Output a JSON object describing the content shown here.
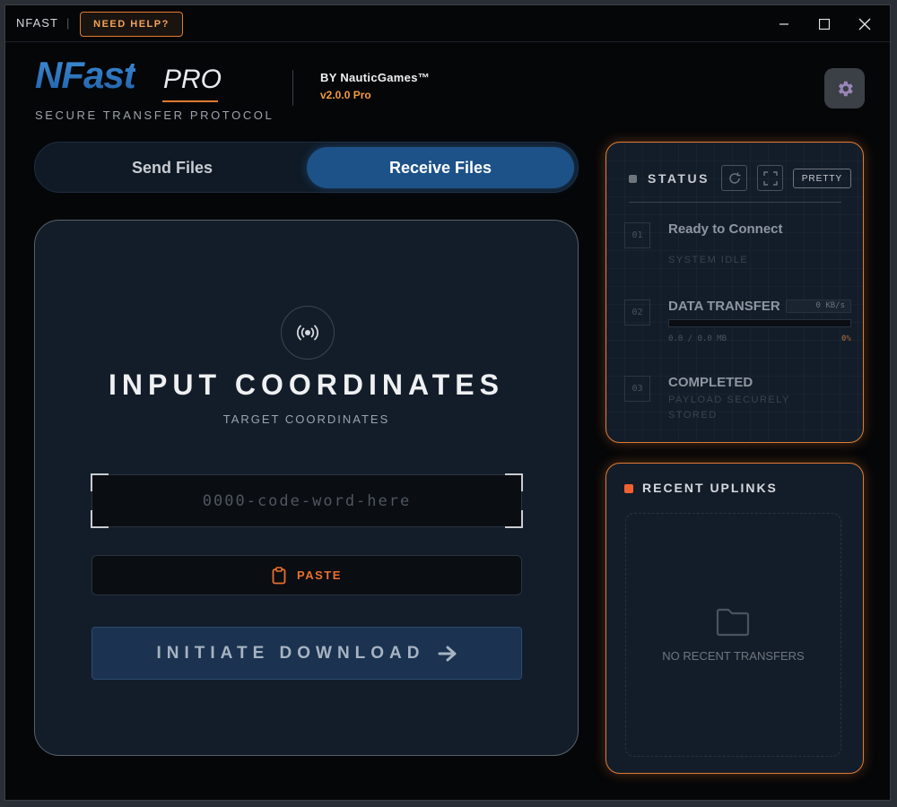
{
  "titlebar": {
    "app_name": "NFAST",
    "separator": "|",
    "help_label": "NEED HELP?"
  },
  "header": {
    "logo_main": "NFast",
    "logo_pro": "PRO",
    "tagline": "SECURE TRANSFER PROTOCOL",
    "by_line": "BY NauticGames™",
    "version": "v2.0.0 Pro"
  },
  "tabs": [
    {
      "label": "Send Files",
      "active": false
    },
    {
      "label": "Receive Files",
      "active": true
    }
  ],
  "receive": {
    "title": "INPUT COORDINATES",
    "subtitle": "TARGET COORDINATES",
    "code_placeholder": "0000-code-word-here",
    "code_value": "",
    "paste_label": "PASTE",
    "download_label": "INITIATE DOWNLOAD"
  },
  "status": {
    "title": "STATUS",
    "pretty_label": "PRETTY",
    "steps": [
      {
        "num": "01",
        "title": "Ready to Connect",
        "sub": "SYSTEM IDLE"
      },
      {
        "num": "02",
        "title": "DATA TRANSFER",
        "speed": "0 KB/s",
        "size": "0.0 / 0.0 MB",
        "percent": "0%",
        "progress": 0
      },
      {
        "num": "03",
        "title": "COMPLETED",
        "sub_line1": "PAYLOAD SECURELY",
        "sub_line2": "STORED"
      }
    ]
  },
  "recent": {
    "title": "RECENT UPLINKS",
    "empty_text": "NO RECENT TRANSFERS"
  },
  "colors": {
    "accent_orange": "#e07a30",
    "accent_blue": "#1c5288",
    "panel_bg": "#131d2a"
  },
  "icons": [
    "minimize-icon",
    "maximize-icon",
    "close-icon",
    "gear-icon",
    "broadcast-icon",
    "clipboard-icon",
    "arrow-right-icon",
    "refresh-icon",
    "expand-icon",
    "folder-icon"
  ]
}
